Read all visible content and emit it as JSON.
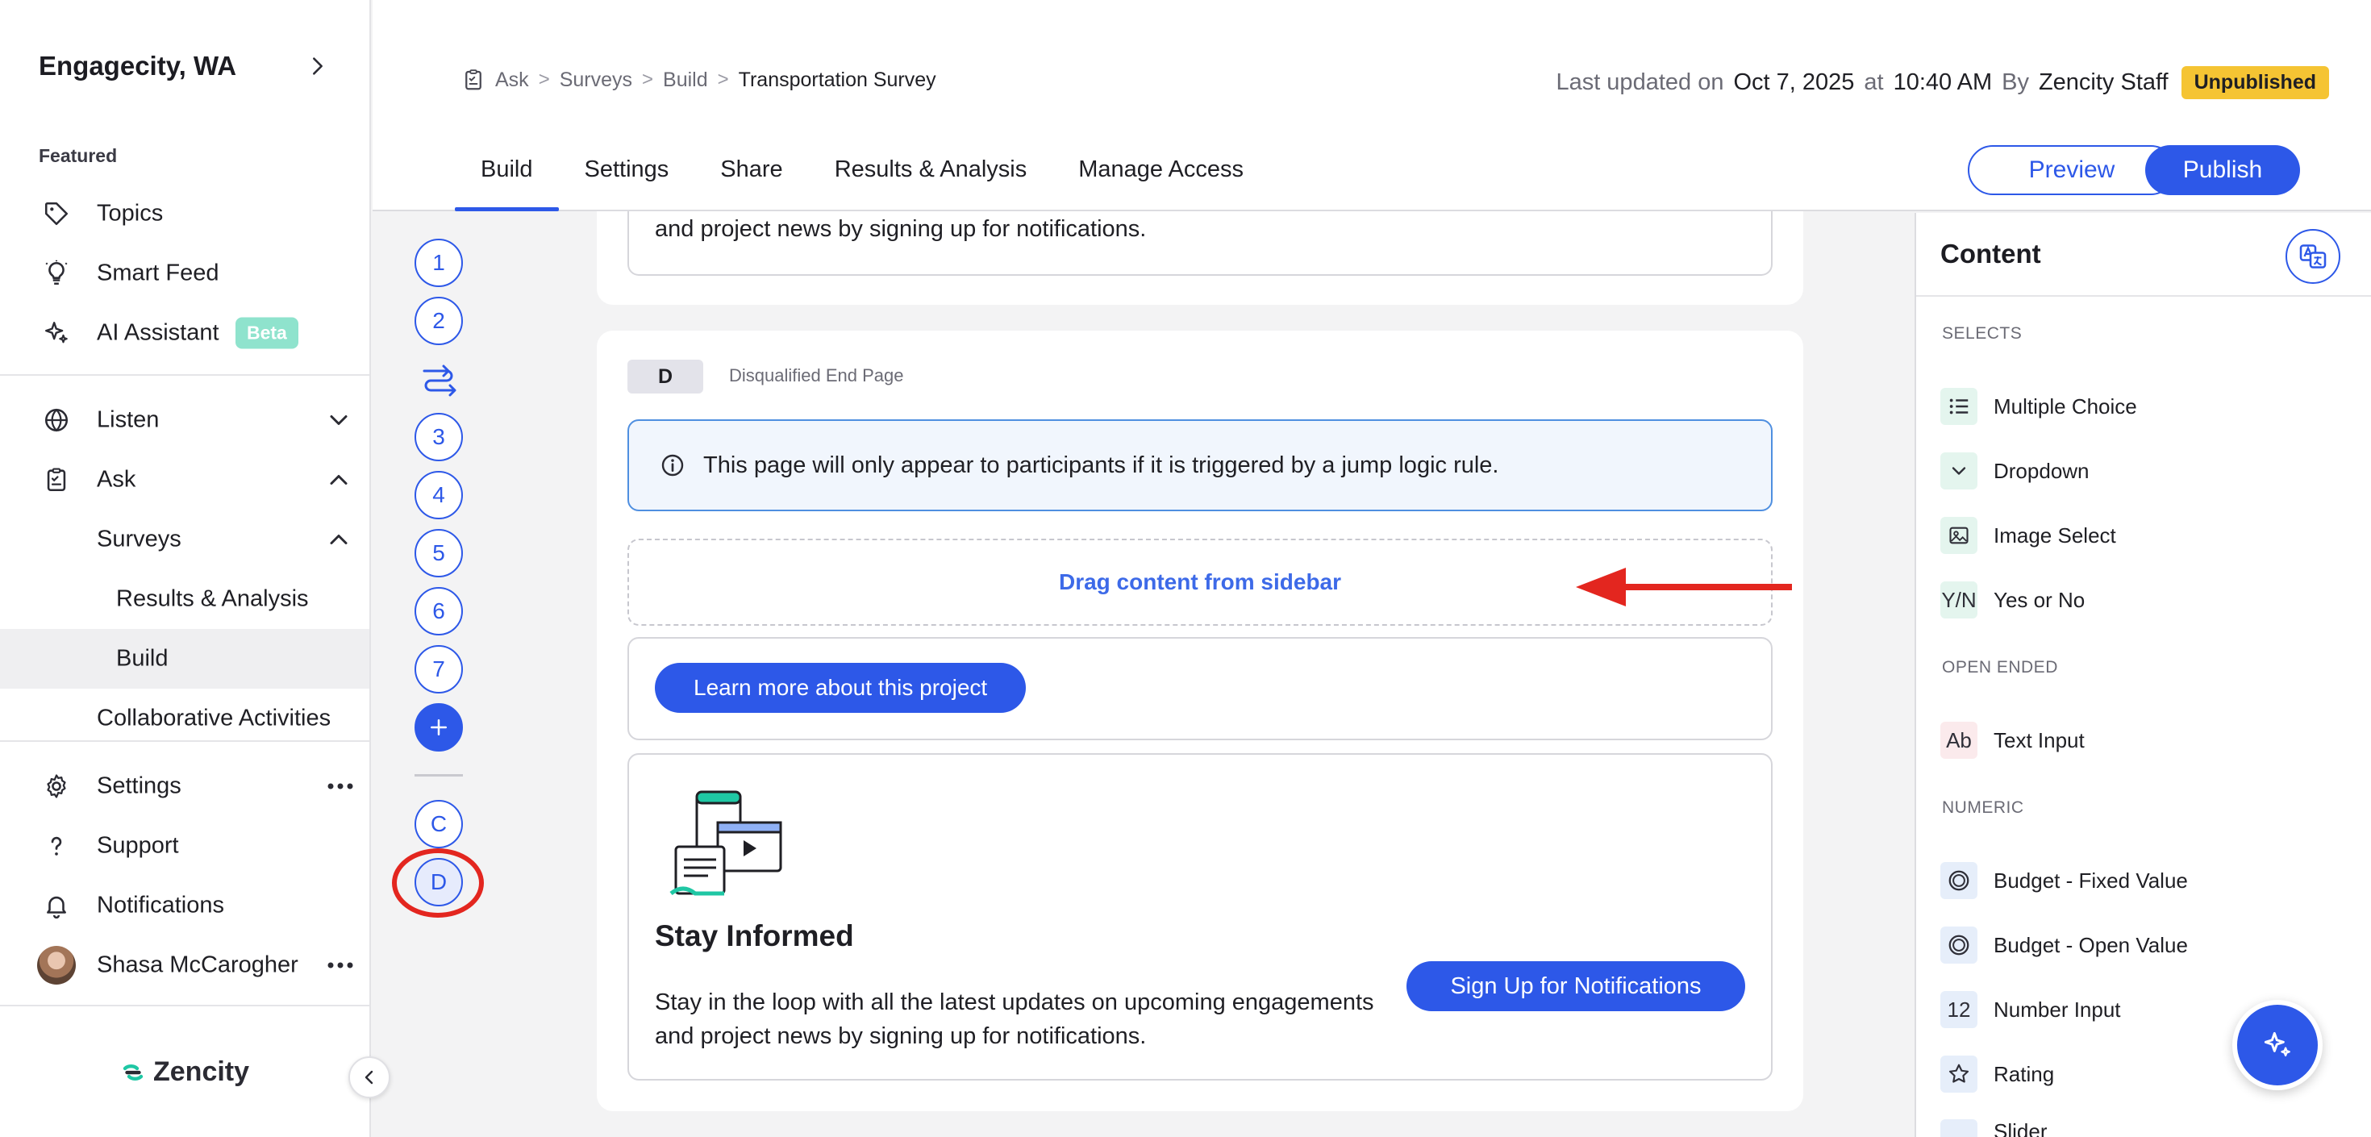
{
  "sidebar": {
    "org_name": "Engagecity, WA",
    "featured_label": "Featured",
    "items": {
      "topics": "Topics",
      "smart_feed": "Smart Feed",
      "ai_assistant": "AI Assistant",
      "beta_badge": "Beta",
      "listen": "Listen",
      "ask": "Ask",
      "surveys": "Surveys",
      "results_analysis": "Results & Analysis",
      "build": "Build",
      "collaborative": "Collaborative Activities",
      "settings": "Settings",
      "support": "Support",
      "notifications": "Notifications",
      "user": "Shasa McCarogher"
    },
    "brand": "Zencity"
  },
  "header": {
    "breadcrumbs": [
      "Ask",
      "Surveys",
      "Build",
      "Transportation Survey"
    ],
    "last_updated_label": "Last updated on",
    "date": "Oct 7, 2025",
    "at_label": "at",
    "time": "10:40 AM",
    "by_label": "By",
    "author": "Zencity Staff",
    "status": "Unpublished",
    "tabs": [
      "Build",
      "Settings",
      "Share",
      "Results & Analysis",
      "Manage Access"
    ],
    "preview_label": "Preview",
    "publish_label": "Publish"
  },
  "steps": {
    "numbers": [
      "1",
      "2",
      "3",
      "4",
      "5",
      "6",
      "7"
    ],
    "add": "+",
    "c": "C",
    "d": "D"
  },
  "canvas": {
    "prev_text": "and project news by signing up for notifications.",
    "page_badge": "D",
    "page_type": "Disqualified End Page",
    "info_text": "This page will only appear to participants if it is triggered by a jump logic rule.",
    "drop_zone": "Drag content from sidebar",
    "learn_more": "Learn more about this project",
    "stay_title": "Stay Informed",
    "stay_body": "Stay in the loop with all the latest updates on upcoming engagements and project news by signing up for notifications.",
    "signup": "Sign Up for Notifications"
  },
  "content_panel": {
    "title": "Content",
    "sections": {
      "selects": "SELECTS",
      "open_ended": "OPEN ENDED",
      "numeric": "NUMERIC"
    },
    "items": {
      "multiple_choice": "Multiple Choice",
      "dropdown": "Dropdown",
      "image_select": "Image Select",
      "yes_no": "Yes or No",
      "yes_no_tile": "Y/N",
      "text_input": "Text Input",
      "text_input_tile": "Ab",
      "budget_fixed": "Budget - Fixed Value",
      "budget_open": "Budget - Open Value",
      "number_input": "Number Input",
      "number_input_tile": "12",
      "rating": "Rating",
      "slider": "Slider"
    }
  },
  "colors": {
    "accent": "#2d58e8",
    "annotation": "#e3261f",
    "unpublished": "#f5c433",
    "beta": "#8fe3cd"
  }
}
